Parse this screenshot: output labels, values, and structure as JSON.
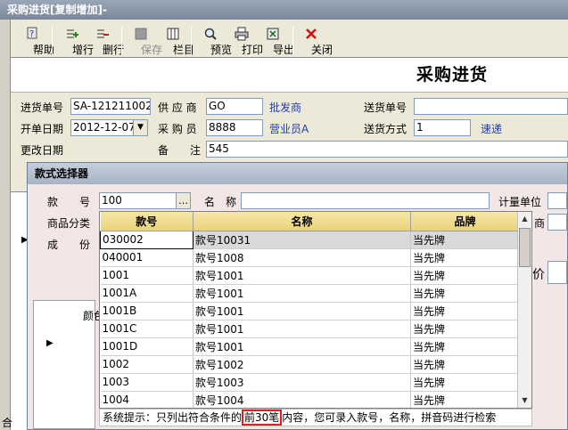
{
  "window": {
    "title": "采购进货[复制增加]-"
  },
  "toolbar": {
    "help": "帮助",
    "add_row": "增行",
    "del_row": "删行",
    "save": "保存",
    "columns": "栏目",
    "preview": "预览",
    "print": "打印",
    "export": "导出",
    "close": "关闭"
  },
  "form": {
    "title": "采购进货",
    "order_no_label": "进货单号",
    "order_no": "SA-121211002",
    "supplier_label": "供 应 商",
    "supplier": "GO",
    "supplier_name": "批发商",
    "delivery_no_label": "送货单号",
    "delivery_no": "",
    "date_label": "开单日期",
    "date": "2012-12-07",
    "buyer_label": "采 购 员",
    "buyer": "8888",
    "buyer_name": "营业员A",
    "delivery_method_label": "送货方式",
    "delivery_method": "1",
    "delivery_method_name": "速递",
    "modified_label": "更改日期",
    "note_label": "备　　注",
    "note": "545"
  },
  "dialog": {
    "title": "款式选择器",
    "style_no_label": "款　　号",
    "style_no": "100",
    "name_label": "名　称",
    "name": "",
    "unit_label": "计量单位",
    "category_label": "商品分类",
    "composition_label": "成　　份",
    "side_label_1": "商",
    "side_label_2": "价",
    "color_label": "颜色",
    "columns": [
      "款号",
      "名称",
      "品牌"
    ],
    "rows": [
      [
        "030002",
        "款号10031",
        "当先牌"
      ],
      [
        "040001",
        "款号1008",
        "当先牌"
      ],
      [
        "1001",
        "款号1001",
        "当先牌"
      ],
      [
        "1001A",
        "款号1001",
        "当先牌"
      ],
      [
        "1001B",
        "款号1001",
        "当先牌"
      ],
      [
        "1001C",
        "款号1001",
        "当先牌"
      ],
      [
        "1001D",
        "款号1001",
        "当先牌"
      ],
      [
        "1002",
        "款号1002",
        "当先牌"
      ],
      [
        "1003",
        "款号1003",
        "当先牌"
      ],
      [
        "1004",
        "款号1004",
        "当先牌"
      ]
    ],
    "hint_prefix": "系统提示：只列出符合条件的",
    "hint_highlight": "前30笔",
    "hint_suffix": "内容，您可录入款号，名称，拼音码进行检索"
  },
  "footer": {
    "total_label": "合"
  },
  "colors": {
    "hint_highlight_border": "#e02020",
    "link": "#1f3fa8",
    "table_header": "#efdc8c"
  }
}
